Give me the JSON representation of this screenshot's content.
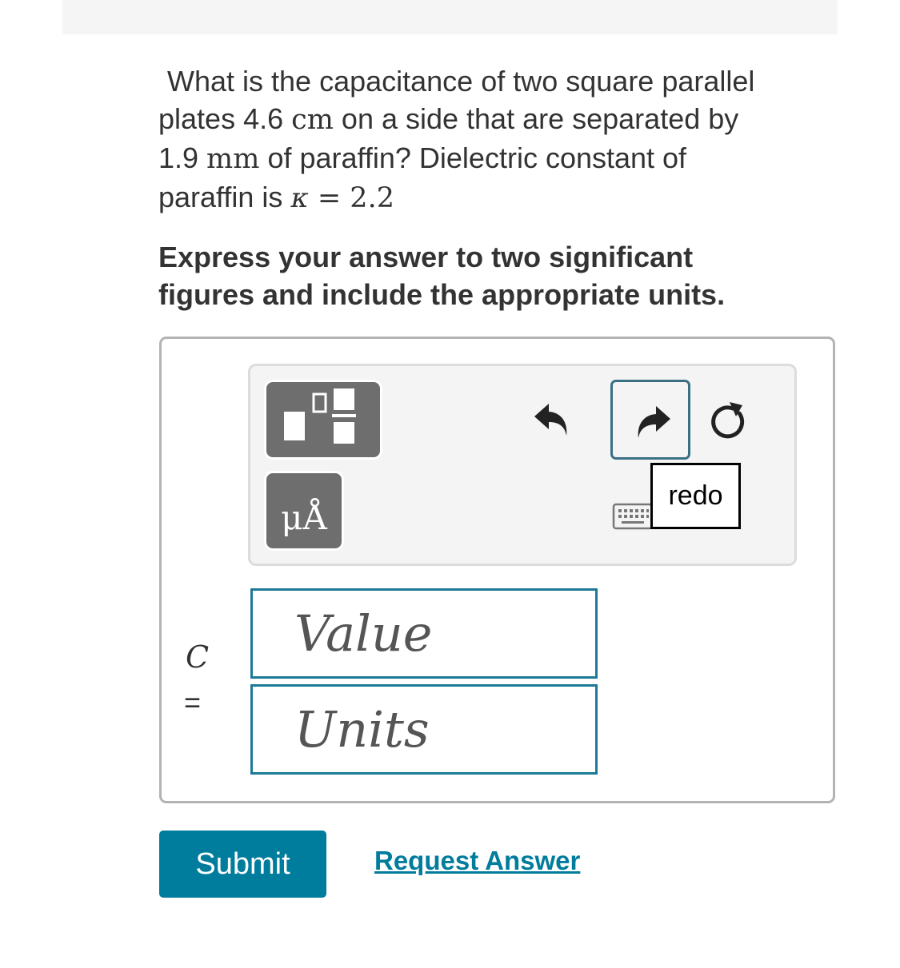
{
  "question": {
    "line1": "What is the capacitance of two square parallel",
    "line2_pre": "plates 4.6 ",
    "line2_unit": "cm",
    "line2_post": " on a side that are separated by",
    "line3_pre": "1.9 ",
    "line3_unit": "mm",
    "line3_post": " of paraffin? Dielectric constant of",
    "line4_pre": "paraffin is ",
    "line4_symbol": "κ",
    "line4_eq": " = 2.2"
  },
  "instruction": {
    "line1": "Express your answer to two significant",
    "line2": "figures and include the appropriate units."
  },
  "toolbar": {
    "templates_icon": "fraction-templates-icon",
    "units_label": "μÅ",
    "undo_icon": "undo-icon",
    "redo_icon": "redo-icon",
    "reset_icon": "reset-icon",
    "keyboard_icon": "keyboard-icon",
    "tooltip": "redo"
  },
  "answer": {
    "variable": "C",
    "equals": "=",
    "value_placeholder": "Value",
    "units_placeholder": "Units"
  },
  "actions": {
    "submit": "Submit",
    "request_answer": "Request Answer"
  },
  "colors": {
    "accent": "#007c9c",
    "field_border": "#1c7a96",
    "tool_button": "#6e6e6e"
  }
}
